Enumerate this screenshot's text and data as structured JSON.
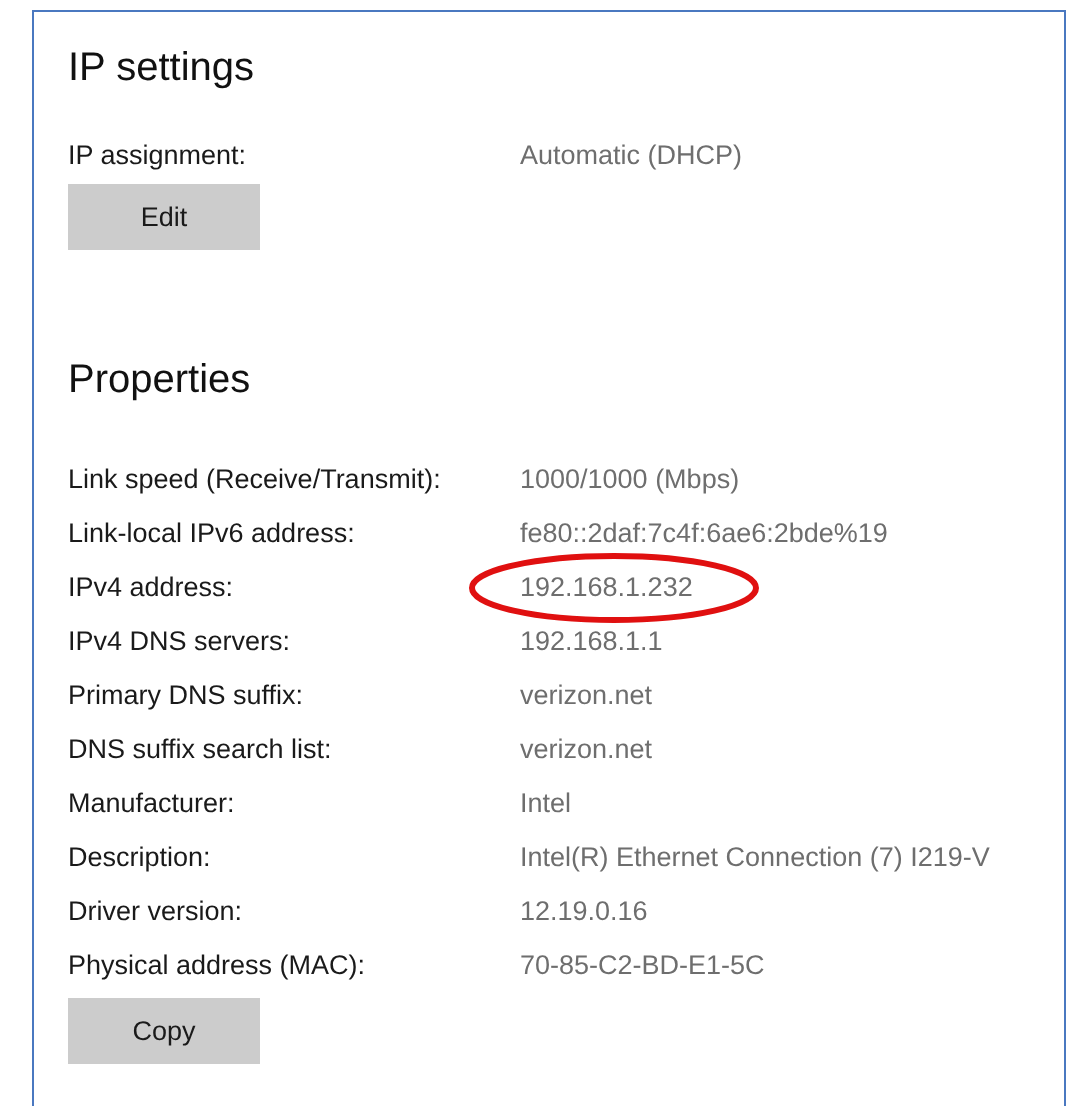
{
  "ip_settings": {
    "title": "IP settings",
    "fields": [
      {
        "label": "IP assignment:",
        "value": "Automatic (DHCP)"
      }
    ],
    "button": "Edit"
  },
  "properties": {
    "title": "Properties",
    "rows": [
      {
        "label": "Link speed (Receive/Transmit):",
        "value": "1000/1000 (Mbps)",
        "circled": false
      },
      {
        "label": "Link-local IPv6 address:",
        "value": "fe80::2daf:7c4f:6ae6:2bde%19",
        "circled": false
      },
      {
        "label": "IPv4 address:",
        "value": "192.168.1.232",
        "circled": true
      },
      {
        "label": "IPv4 DNS servers:",
        "value": "192.168.1.1",
        "circled": false
      },
      {
        "label": "Primary DNS suffix:",
        "value": "verizon.net",
        "circled": false
      },
      {
        "label": "DNS suffix search list:",
        "value": "verizon.net",
        "circled": false
      },
      {
        "label": "Manufacturer:",
        "value": "Intel",
        "circled": false
      },
      {
        "label": "Description:",
        "value": "Intel(R) Ethernet Connection (7) I219-V",
        "circled": false
      },
      {
        "label": "Driver version:",
        "value": "12.19.0.16",
        "circled": false
      },
      {
        "label": "Physical address (MAC):",
        "value": "70-85-C2-BD-E1-5C",
        "circled": false
      }
    ],
    "button": "Copy"
  }
}
